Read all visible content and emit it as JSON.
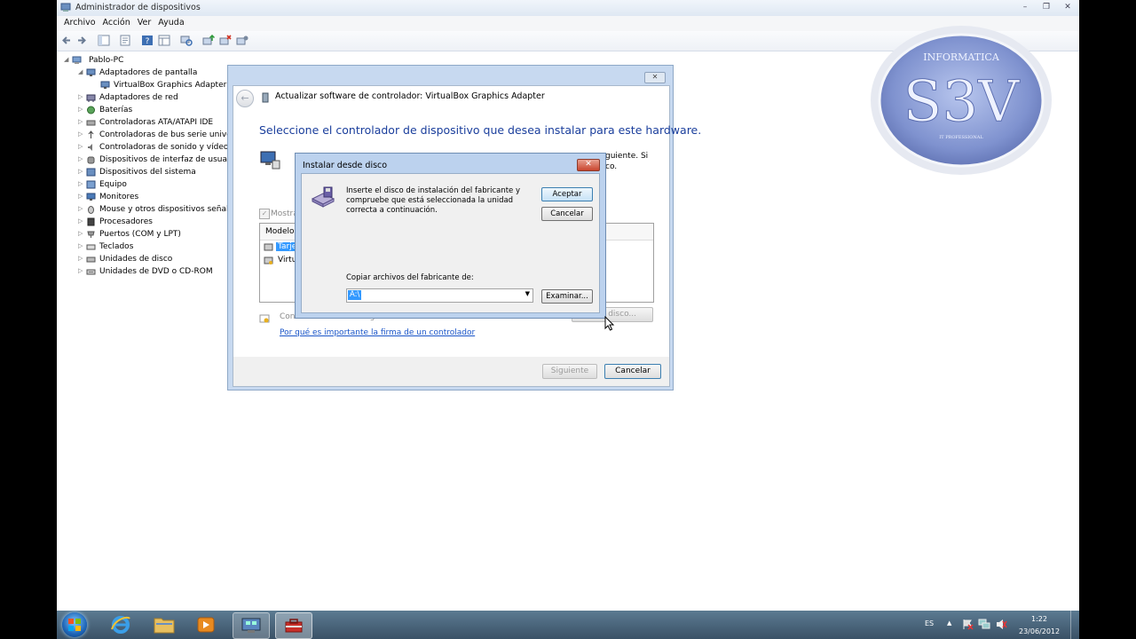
{
  "window": {
    "title": "Administrador de dispositivos"
  },
  "menu": [
    "Archivo",
    "Acción",
    "Ver",
    "Ayuda"
  ],
  "tree": {
    "root": "Pablo-PC",
    "items": [
      "Adaptadores de pantalla",
      "VirtualBox Graphics Adapter",
      "Adaptadores de red",
      "Baterías",
      "Controladoras ATA/ATAPI IDE",
      "Controladoras de bus serie univer",
      "Controladoras de sonido y vídeo y",
      "Dispositivos de interfaz de usuario",
      "Dispositivos del sistema",
      "Equipo",
      "Monitores",
      "Mouse y otros dispositivos señala",
      "Procesadores",
      "Puertos (COM y LPT)",
      "Teclados",
      "Unidades de disco",
      "Unidades de DVD o CD-ROM"
    ]
  },
  "wizard": {
    "title": "Actualizar software de controlador: VirtualBox Graphics Adapter",
    "heading": "Seleccione el controlador de dispositivo que desea instalar para este hardware.",
    "side_text_1": "guiente. Si",
    "side_text_2": "co.",
    "checkbox_label": "Mostra",
    "list_header": "Modelo",
    "list_item_1": "Tarje",
    "list_item_2": "Virtu",
    "signed_text": "Controlador firmado digitalmente.",
    "have_disk_label": "disco...",
    "link": "Por qué es importante la firma de un controlador",
    "next_label": "Siguiente",
    "cancel_label": "Cancelar"
  },
  "disk_dialog": {
    "title": "Instalar desde disco",
    "message": "Inserte el disco de instalación del fabricante y compruebe que está seleccionada la unidad correcta a continuación.",
    "ok_label": "Aceptar",
    "cancel_label": "Cancelar",
    "copy_label": "Copiar archivos del fabricante de:",
    "path_value": "A:\\",
    "browse_label": "Examinar..."
  },
  "watermark": {
    "top": "INFORMATICA",
    "main": "S3V",
    "bottom": "IT PROFESSIONAL"
  },
  "tray": {
    "language": "ES",
    "time": "1:22",
    "date": "23/06/2012"
  },
  "colors": {
    "heading": "#1a3e9c",
    "selection": "#3399ff",
    "link": "#1a55c8"
  }
}
